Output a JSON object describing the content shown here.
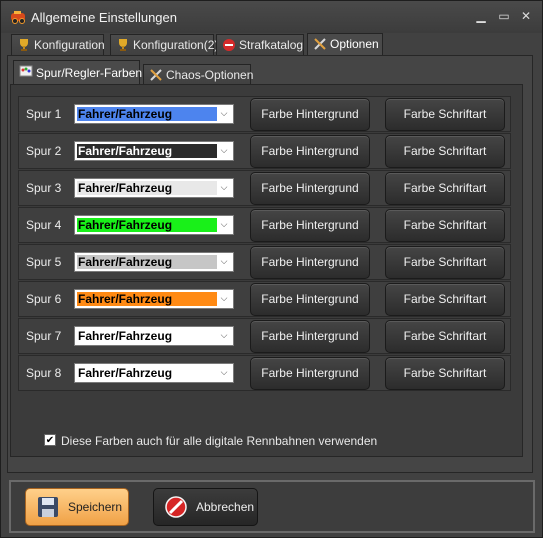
{
  "window": {
    "title": "Allgemeine Einstellungen"
  },
  "tabs": [
    {
      "label": "Konfiguration",
      "icon": "trophy-icon",
      "active": false
    },
    {
      "label": "Konfiguration(2)",
      "icon": "trophy-icon",
      "active": false
    },
    {
      "label": "Strafkatalog",
      "icon": "no-entry-icon",
      "active": false
    },
    {
      "label": "Optionen",
      "icon": "tools-icon",
      "active": true
    }
  ],
  "subtabs": [
    {
      "label": "Spur/Regler-Farben",
      "icon": "palette-icon",
      "active": true
    },
    {
      "label": "Chaos-Optionen",
      "icon": "tools-icon",
      "active": false
    }
  ],
  "rows": [
    {
      "label": "Spur 1",
      "value": "Fahrer/Fahrzeug",
      "color": "#4d84ee",
      "btn_bg": "Farbe Hintergrund",
      "btn_fg": "Farbe Schriftart"
    },
    {
      "label": "Spur 2",
      "value": "Fahrer/Fahrzeug",
      "color": "#2b2b2b",
      "text_color": "#ffffff",
      "btn_bg": "Farbe Hintergrund",
      "btn_fg": "Farbe Schriftart"
    },
    {
      "label": "Spur 3",
      "value": "Fahrer/Fahrzeug",
      "color": "#e8e8e8",
      "btn_bg": "Farbe Hintergrund",
      "btn_fg": "Farbe Schriftart"
    },
    {
      "label": "Spur 4",
      "value": "Fahrer/Fahrzeug",
      "color": "#19f019",
      "btn_bg": "Farbe Hintergrund",
      "btn_fg": "Farbe Schriftart"
    },
    {
      "label": "Spur 5",
      "value": "Fahrer/Fahrzeug",
      "color": "#c6c6c6",
      "btn_bg": "Farbe Hintergrund",
      "btn_fg": "Farbe Schriftart"
    },
    {
      "label": "Spur 6",
      "value": "Fahrer/Fahrzeug",
      "color": "#ff8a14",
      "btn_bg": "Farbe Hintergrund",
      "btn_fg": "Farbe Schriftart"
    },
    {
      "label": "Spur 7",
      "value": "Fahrer/Fahrzeug",
      "color": "#ffffff",
      "btn_bg": "Farbe Hintergrund",
      "btn_fg": "Farbe Schriftart"
    },
    {
      "label": "Spur 8",
      "value": "Fahrer/Fahrzeug",
      "color": "#ffffff",
      "btn_bg": "Farbe Hintergrund",
      "btn_fg": "Farbe Schriftart"
    }
  ],
  "checkbox": {
    "label": "Diese Farben auch für alle digitale Rennbahnen verwenden",
    "checked": true
  },
  "footer": {
    "save_label": "Speichern",
    "cancel_label": "Abbrechen"
  }
}
